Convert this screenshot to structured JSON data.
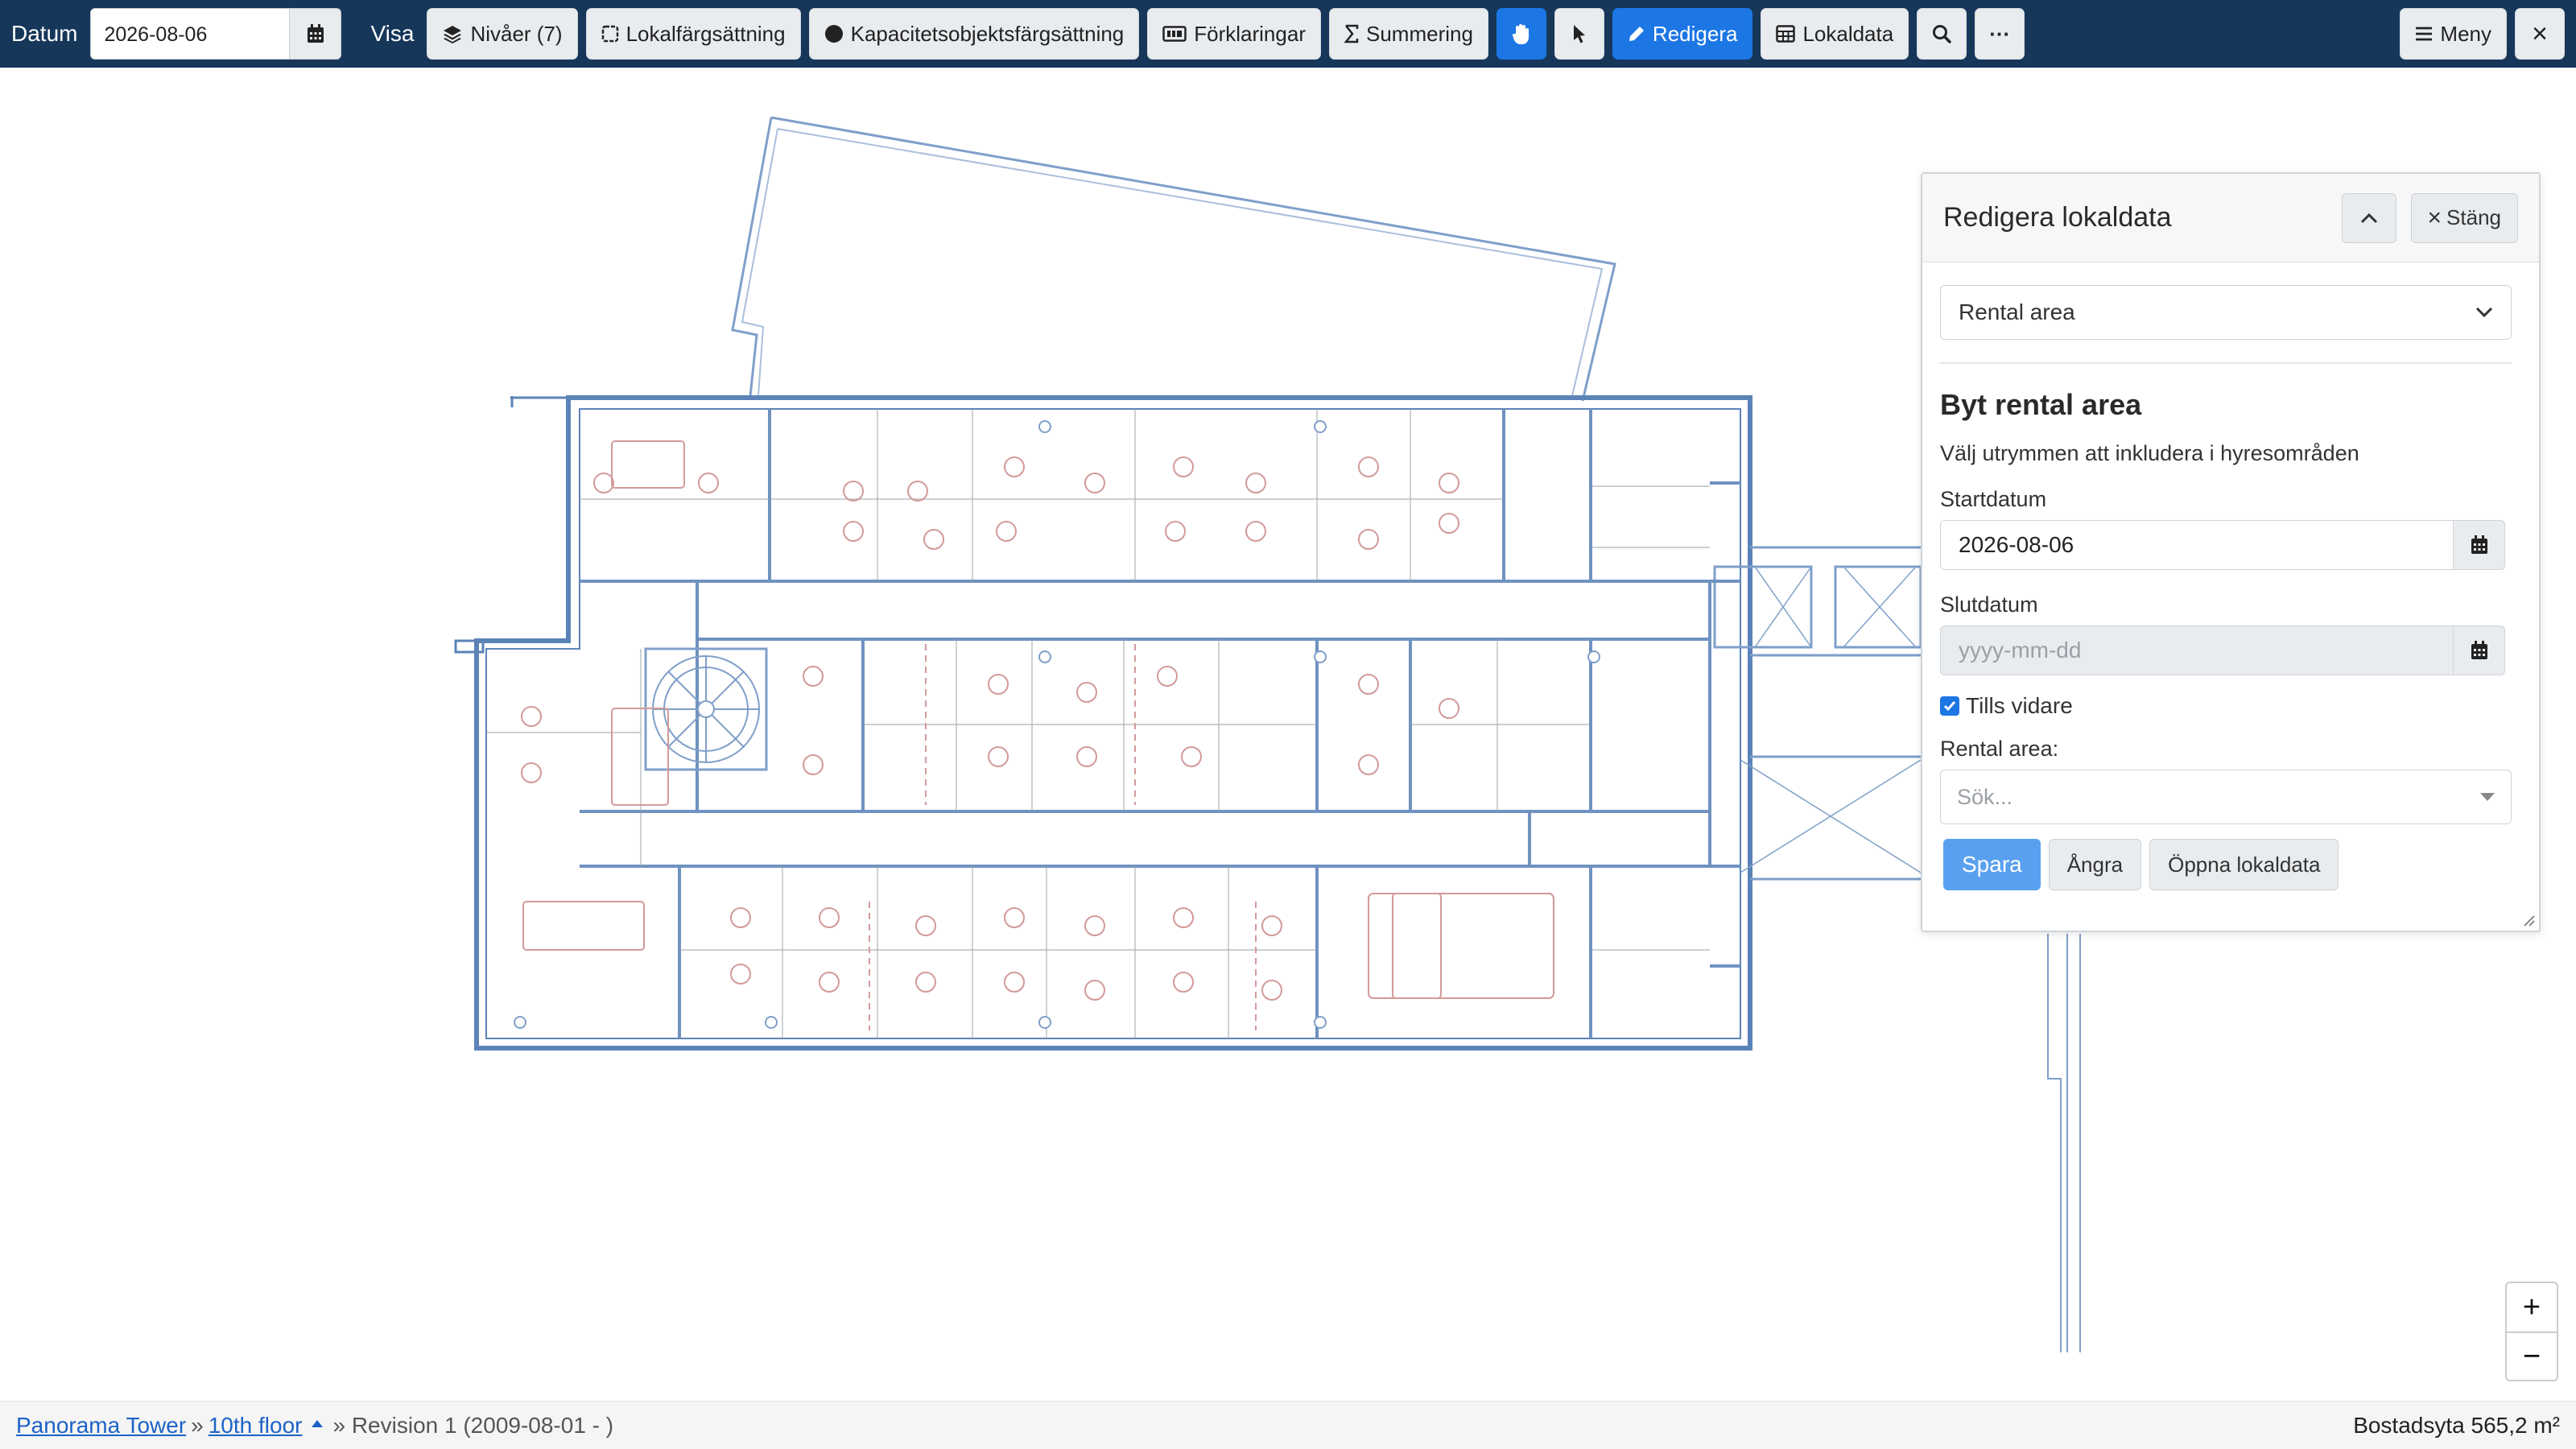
{
  "toolbar": {
    "date_label": "Datum",
    "date_value": "2026-08-06",
    "view_label": "Visa",
    "buttons": {
      "levels": "Nivåer (7)",
      "room_coloring": "Lokalfärgsättning",
      "capacity_coloring": "Kapacitetsobjektsfärgsättning",
      "legends": "Förklaringar",
      "summation": "Summering",
      "edit": "Redigera",
      "room_data": "Lokaldata",
      "more": "···",
      "menu": "Meny",
      "close": "×"
    }
  },
  "panel": {
    "title": "Redigera lokaldata",
    "close_label": "Stäng",
    "mode_select": "Rental area",
    "section_title": "Byt rental area",
    "description": "Välj utrymmen att inkludera i hyresområden",
    "start_label": "Startdatum",
    "start_value": "2026-08-06",
    "end_label": "Slutdatum",
    "end_placeholder": "yyyy-mm-dd",
    "until_further_label": "Tills vidare",
    "until_further_checked": true,
    "rental_area_label": "Rental area:",
    "rental_area_placeholder": "Sök...",
    "save_label": "Spara",
    "undo_label": "Ångra",
    "open_label": "Öppna lokaldata"
  },
  "zoom": {
    "in": "+",
    "out": "−"
  },
  "status": {
    "building": "Panorama Tower",
    "separator": "»",
    "floor": "10th floor",
    "revision": "» Revision 1 (2009-08-01 - )",
    "area": "Bostadsyta 565,2 m²"
  },
  "colors": {
    "toolbar_bg": "#16375a",
    "accent": "#1c76e4",
    "plan_wall": "#5b83b8",
    "furniture": "#d39a9a"
  }
}
